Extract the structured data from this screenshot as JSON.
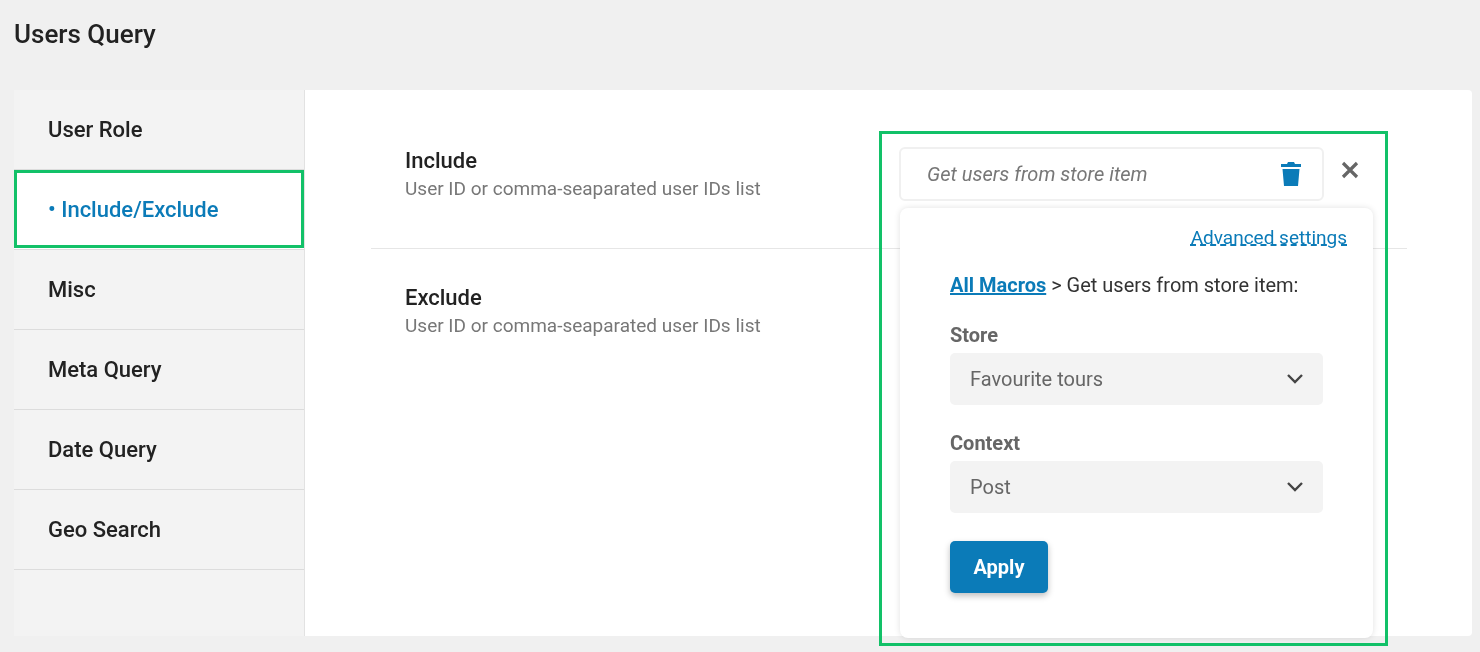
{
  "title": "Users Query",
  "sidebar": {
    "items": [
      {
        "label": "User Role",
        "selected": false
      },
      {
        "label": "• Include/Exclude",
        "selected": true
      },
      {
        "label": "Misc",
        "selected": false
      },
      {
        "label": "Meta Query",
        "selected": false
      },
      {
        "label": "Date Query",
        "selected": false
      },
      {
        "label": "Geo Search",
        "selected": false
      }
    ]
  },
  "fields": [
    {
      "label": "Include",
      "description": "User ID or comma-seaparated user IDs list"
    },
    {
      "label": "Exclude",
      "description": "User ID or comma-seaparated user IDs list"
    }
  ],
  "macro_popover": {
    "input": {
      "placeholder": "Get users from store item"
    },
    "advanced_link": "Advanced settings",
    "breadcrumb": {
      "link": "All Macros",
      "text": " > Get users from store item:"
    },
    "selects": [
      {
        "label": "Store",
        "value": "Favourite tours"
      },
      {
        "label": "Context",
        "value": "Post"
      }
    ],
    "apply_button": "Apply"
  }
}
